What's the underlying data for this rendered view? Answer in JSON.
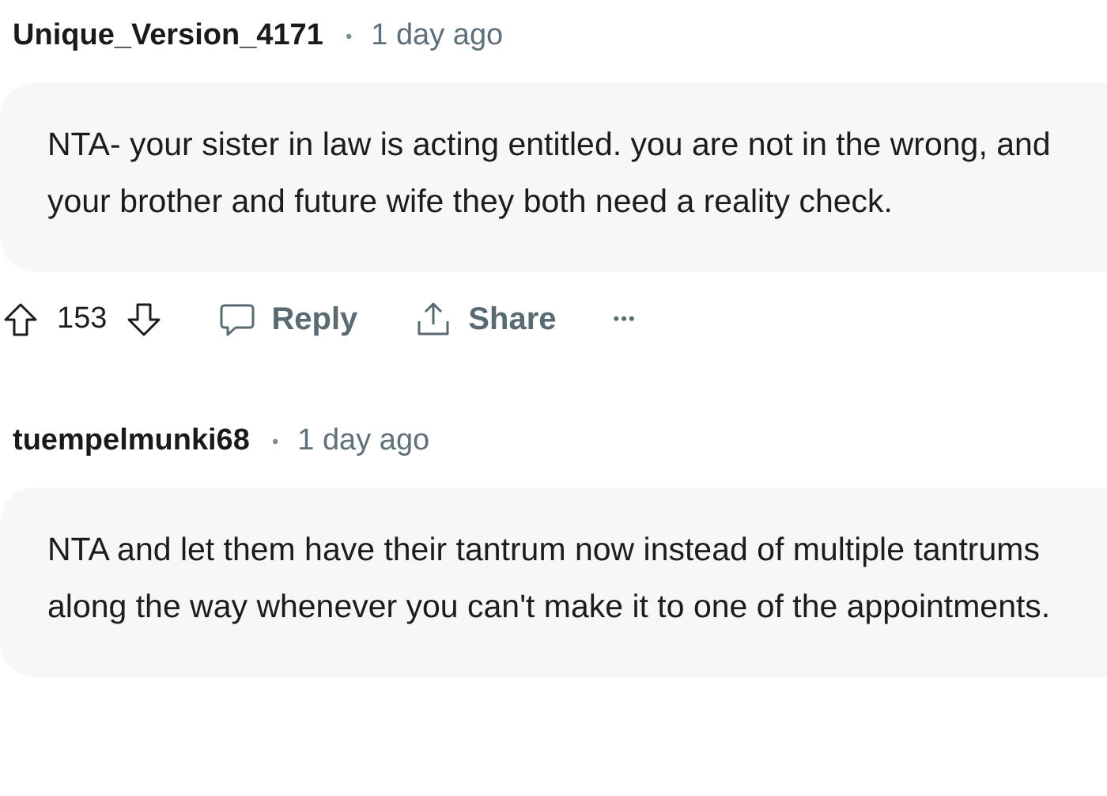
{
  "comments": [
    {
      "author": "Unique_Version_4171",
      "separator": "•",
      "time": "1 day ago",
      "body": "NTA- your sister in law is acting entitled. you are not in the wrong, and your brother and future wife they both need a reality check.",
      "actions": {
        "score": "153",
        "reply": "Reply",
        "share": "Share",
        "more": "•••"
      }
    },
    {
      "author": "tuempelmunki68",
      "separator": "•",
      "time": "1 day ago",
      "body": "NTA and let them have their tantrum now instead of multiple tantrums along the way whenever you can't make it to one of the appointments."
    }
  ]
}
